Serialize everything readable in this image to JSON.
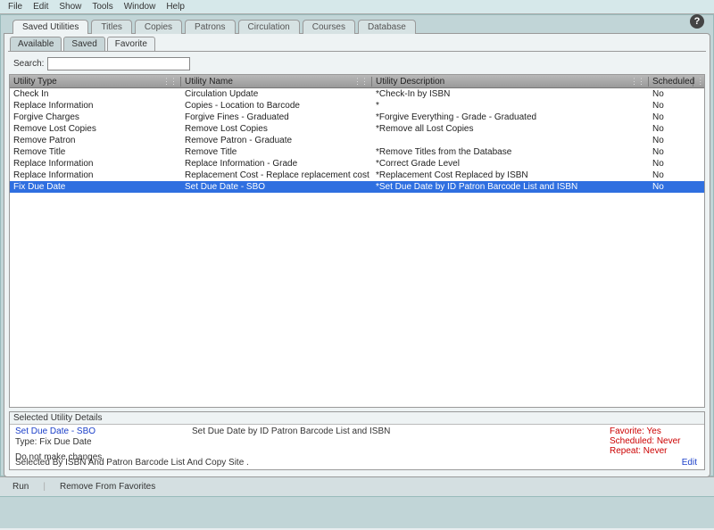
{
  "menu": {
    "items": [
      "File",
      "Edit",
      "Show",
      "Tools",
      "Window",
      "Help"
    ]
  },
  "help_icon": "?",
  "tabs_primary": [
    {
      "label": "Saved Utilities",
      "active": true
    },
    {
      "label": "Titles",
      "active": false
    },
    {
      "label": "Copies",
      "active": false
    },
    {
      "label": "Patrons",
      "active": false
    },
    {
      "label": "Circulation",
      "active": false
    },
    {
      "label": "Courses",
      "active": false
    },
    {
      "label": "Database",
      "active": false
    }
  ],
  "tabs_secondary": [
    {
      "label": "Available",
      "active": false
    },
    {
      "label": "Saved",
      "active": false
    },
    {
      "label": "Favorite",
      "active": true
    }
  ],
  "search": {
    "label": "Search:",
    "value": ""
  },
  "table": {
    "columns": [
      "Utility Type",
      "Utility Name",
      "Utility Description",
      "Scheduled"
    ],
    "rows": [
      {
        "type": "Check In",
        "name": "Circulation Update",
        "desc": "*Check-In by ISBN",
        "sched": "No",
        "selected": false
      },
      {
        "type": "Replace Information",
        "name": "Copies - Location to Barcode",
        "desc": "*",
        "sched": "No",
        "selected": false
      },
      {
        "type": "Forgive Charges",
        "name": "Forgive Fines - Graduated",
        "desc": "*Forgive Everything - Grade - Graduated",
        "sched": "No",
        "selected": false
      },
      {
        "type": "Remove Lost Copies",
        "name": "Remove Lost Copies",
        "desc": "*Remove all Lost Copies",
        "sched": "No",
        "selected": false
      },
      {
        "type": "Remove Patron",
        "name": "Remove Patron - Graduate",
        "desc": "",
        "sched": "No",
        "selected": false
      },
      {
        "type": "Remove Title",
        "name": "Remove Title",
        "desc": "*Remove Titles from the Database",
        "sched": "No",
        "selected": false
      },
      {
        "type": "Replace Information",
        "name": "Replace Information - Grade",
        "desc": "*Correct Grade Level",
        "sched": "No",
        "selected": false
      },
      {
        "type": "Replace Information",
        "name": "Replacement Cost - Replace replacement cost",
        "desc": "*Replacement Cost Replaced by ISBN",
        "sched": "No",
        "selected": false
      },
      {
        "type": "Fix Due Date",
        "name": "Set Due Date - SBO",
        "desc": "*Set Due Date by ID Patron Barcode List and ISBN",
        "sched": "No",
        "selected": true
      }
    ]
  },
  "details": {
    "section_title": "Selected Utility Details",
    "name": "Set Due Date - SBO",
    "type_line": "Type: Fix Due Date",
    "nochanges": "Do not make changes",
    "description": "Set Due Date by ID Patron Barcode List and ISBN",
    "selected_by": "Selected By ISBN  And Patron Barcode List  And Copy Site .",
    "favorite": "Favorite: Yes",
    "scheduled": "Scheduled: Never",
    "repeat": "Repeat: Never",
    "edit": "Edit"
  },
  "actions": {
    "run": "Run",
    "remove": "Remove From Favorites"
  }
}
